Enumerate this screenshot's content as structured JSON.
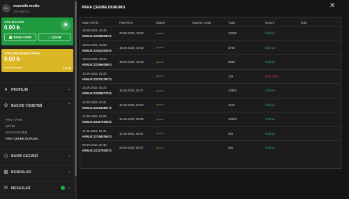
{
  "user": {
    "avatar_text": "M/n",
    "name": "mustafa mutlu",
    "id": "1/6/19/87/16"
  },
  "main_balance": {
    "label": "ANA BAKİYE",
    "value": "0.00 ₺",
    "deposit_label": "PARA YATIR",
    "withdraw_label": "ÇEKİM",
    "eye_icon": "eye-icon"
  },
  "bonus_balance": {
    "label": "TOPLAM BONUS PARA",
    "value": "0.00 ₺",
    "sub_label": "Bonus Bakiyesi",
    "sub_value": "0.00 ₺"
  },
  "nav": {
    "profile": "PROFİLİM",
    "balance": "BAKİYE YÖNETİMİ",
    "balance_items": [
      "PARA YATIR",
      "ÇEKİM",
      "İŞLEM GEÇMİŞİ",
      "PARA ÇEKME DURUMU"
    ],
    "bets": "BAHİS GEÇMİŞİ",
    "bonuses": "BONUSLAR",
    "messages": "MESAJLAR"
  },
  "modal": {
    "title": "PARA ÇEKME DURUMU",
    "close": "✕",
    "columns": [
      "Date And ID",
      "Paid Time",
      "Sistem",
      "Voucher Code",
      "Tutar",
      "Durum",
      "İptal"
    ],
    "rows": [
      {
        "date": "23.09.2023, 12:40",
        "id": "KIMLIK:223496293",
        "paid": "23.09.2023, 12:03",
        "system": "paparaa",
        "amount": "10200",
        "status": "Ödendi",
        "status_type": "ok"
      },
      {
        "date": "19.09.2023, 19:08",
        "id": "KIMLIK:224413025",
        "paid": "19.09.2023, 19:10",
        "system": "paparaa",
        "amount": "3700",
        "status": "Ödendi",
        "status_type": "ok"
      },
      {
        "date": "18.09.2023, 19:14",
        "id": "KIMLIK:222965298",
        "paid": "18.09.2023, 18:16",
        "system": "paparaa",
        "amount": "5800",
        "status": "Ödendi",
        "status_type": "ok"
      },
      {
        "date": "14.09.2023, 01:20",
        "id": "KIMLIK:222701367",
        "paid": "",
        "system": "paparaa",
        "amount": "139",
        "status": "İptal edildi",
        "status_type": "bad"
      },
      {
        "date": "14.09.2023, 01:22",
        "id": "KIMLIK:222699779",
        "paid": "14.09.2023, 01:27",
        "system": "paparaa",
        "amount": "14800",
        "status": "Ödendi",
        "status_type": "ok"
      },
      {
        "date": "12.09.2023, 20:21",
        "id": "KIMLIK:222235897",
        "paid": "12.09.2023, 20:23",
        "system": "paparaa",
        "amount": "1210",
        "status": "Ödendi",
        "status_type": "ok"
      },
      {
        "date": "12.09.2023, 04:06",
        "id": "KIMLIK:222170205",
        "paid": "12.09.2023, 04:08",
        "system": "paparaa",
        "amount": "10000",
        "status": "Ödendi",
        "status_type": "ok"
      },
      {
        "date": "11.09.2023, 13:49",
        "id": "KIMLIK:221982094",
        "paid": "11.09.2023, 13:50",
        "system": "paparaa",
        "amount": "500",
        "status": "Ödendi",
        "status_type": "ok"
      },
      {
        "date": "09.09.2023, 00:46",
        "id": "KIMLIK:221279202",
        "paid": "09.09.2023, 00:47",
        "system": "paparaa",
        "amount": "250",
        "status": "Ödendi",
        "status_type": "ok"
      }
    ]
  },
  "colors": {
    "green": "#1f9a3e",
    "bonus": "#dab624",
    "ok": "#2fb04f",
    "cancel": "#e03030"
  }
}
